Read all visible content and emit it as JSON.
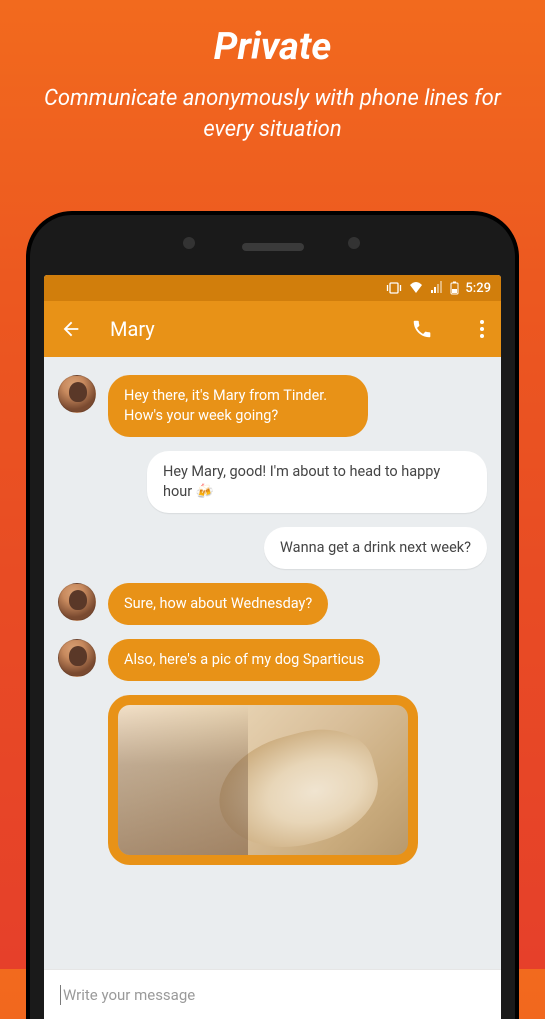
{
  "promo": {
    "title": "Private",
    "subtitle": "Communicate anonymously with phone lines for every situation"
  },
  "status_bar": {
    "time": "5:29"
  },
  "app_bar": {
    "title": "Mary"
  },
  "messages": [
    {
      "direction": "incoming",
      "show_avatar": true,
      "text": "Hey there, it's Mary from Tinder. How's your week going?"
    },
    {
      "direction": "outgoing",
      "show_avatar": false,
      "text": "Hey Mary, good! I'm about to head to happy hour 🍻"
    },
    {
      "direction": "outgoing",
      "show_avatar": false,
      "text": "Wanna get a drink next week?"
    },
    {
      "direction": "incoming",
      "show_avatar": true,
      "text": "Sure, how about Wednesday?"
    },
    {
      "direction": "incoming",
      "show_avatar": true,
      "text": "Also, here's a pic of my dog Sparticus"
    }
  ],
  "input": {
    "placeholder": "Write your message"
  }
}
